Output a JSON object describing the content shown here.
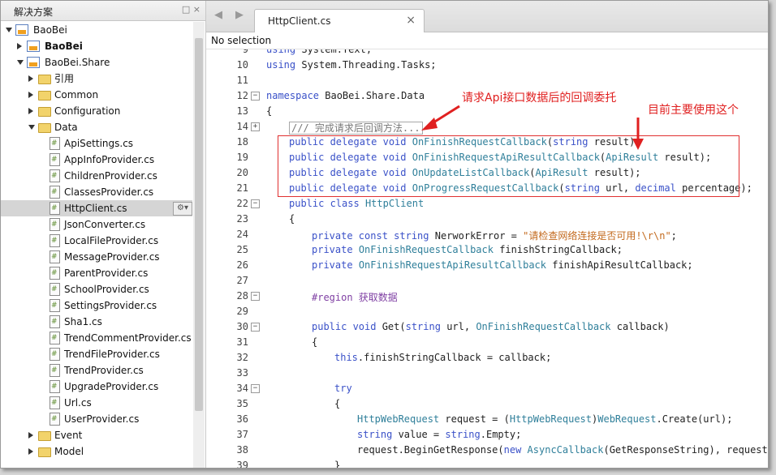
{
  "sidebar": {
    "title": "解决方案",
    "header_buttons": "□ ×",
    "items": [
      {
        "label": "BaoBei",
        "icon": "solution-icon"
      },
      {
        "label": "BaoBei",
        "icon": "project-icon"
      },
      {
        "label": "BaoBei.Share",
        "icon": "project-icon"
      },
      {
        "label": "引用",
        "icon": "folder-icon"
      },
      {
        "label": "Common",
        "icon": "folder-icon"
      },
      {
        "label": "Configuration",
        "icon": "folder-icon"
      },
      {
        "label": "Data",
        "icon": "folder-icon"
      },
      {
        "label": "ApiSettings.cs",
        "icon": "cs-file-icon"
      },
      {
        "label": "AppInfoProvider.cs",
        "icon": "cs-file-icon"
      },
      {
        "label": "ChildrenProvider.cs",
        "icon": "cs-file-icon"
      },
      {
        "label": "ClassesProvider.cs",
        "icon": "cs-file-icon"
      },
      {
        "label": "HttpClient.cs",
        "icon": "cs-file-icon"
      },
      {
        "label": "JsonConverter.cs",
        "icon": "cs-file-icon"
      },
      {
        "label": "LocalFileProvider.cs",
        "icon": "cs-file-icon"
      },
      {
        "label": "MessageProvider.cs",
        "icon": "cs-file-icon"
      },
      {
        "label": "ParentProvider.cs",
        "icon": "cs-file-icon"
      },
      {
        "label": "SchoolProvider.cs",
        "icon": "cs-file-icon"
      },
      {
        "label": "SettingsProvider.cs",
        "icon": "cs-file-icon"
      },
      {
        "label": "Sha1.cs",
        "icon": "cs-file-icon"
      },
      {
        "label": "TrendCommentProvider.cs",
        "icon": "cs-file-icon"
      },
      {
        "label": "TrendFileProvider.cs",
        "icon": "cs-file-icon"
      },
      {
        "label": "TrendProvider.cs",
        "icon": "cs-file-icon"
      },
      {
        "label": "UpgradeProvider.cs",
        "icon": "cs-file-icon"
      },
      {
        "label": "Url.cs",
        "icon": "cs-file-icon"
      },
      {
        "label": "UserProvider.cs",
        "icon": "cs-file-icon"
      },
      {
        "label": "Event",
        "icon": "folder-icon"
      },
      {
        "label": "Model",
        "icon": "folder-icon"
      }
    ],
    "selected": "HttpClient.cs"
  },
  "editor": {
    "tab_label": "HttpClient.cs",
    "tab_close": "×",
    "breadcrumb": "No selection",
    "nav_back": "◀",
    "nav_forward": "▶",
    "lines": [
      {
        "n": "9",
        "text": "using System.Text;"
      },
      {
        "n": "10",
        "text": "using System.Threading.Tasks;"
      },
      {
        "n": "11",
        "text": ""
      },
      {
        "n": "12",
        "text": "namespace BaoBei.Share.Data"
      },
      {
        "n": "13",
        "text": "{"
      },
      {
        "n": "14",
        "text": "/// 完成请求后回调方法..."
      },
      {
        "n": "18",
        "text": "public delegate void OnFinishRequestCallback(string result);"
      },
      {
        "n": "19",
        "text": "public delegate void OnFinishRequestApiResultCallback(ApiResult result);"
      },
      {
        "n": "20",
        "text": "public delegate void OnUpdateListCallback(ApiResult result);"
      },
      {
        "n": "21",
        "text": "public delegate void OnProgressRequestCallback(string url, decimal percentage);"
      },
      {
        "n": "22",
        "text": "public class HttpClient"
      },
      {
        "n": "23",
        "text": "{"
      },
      {
        "n": "24",
        "text": "private const string NerworkError = \"请检查网络连接是否可用!\\r\\n\";"
      },
      {
        "n": "25",
        "text": "private OnFinishRequestCallback finishStringCallback;"
      },
      {
        "n": "26",
        "text": "private OnFinishRequestApiResultCallback finishApiResultCallback;"
      },
      {
        "n": "27",
        "text": ""
      },
      {
        "n": "28",
        "text": "#region 获取数据"
      },
      {
        "n": "29",
        "text": ""
      },
      {
        "n": "30",
        "text": "public void Get(string url, OnFinishRequestCallback callback)"
      },
      {
        "n": "31",
        "text": "{"
      },
      {
        "n": "32",
        "text": "this.finishStringCallback = callback;"
      },
      {
        "n": "33",
        "text": ""
      },
      {
        "n": "34",
        "text": "try"
      },
      {
        "n": "35",
        "text": "{"
      },
      {
        "n": "36",
        "text": "HttpWebRequest request = (HttpWebRequest)WebRequest.Create(url);"
      },
      {
        "n": "37",
        "text": "string value = string.Empty;"
      },
      {
        "n": "38",
        "text": "request.BeginGetResponse(new AsyncCallback(GetResponseString), request);"
      },
      {
        "n": "39",
        "text": "}"
      }
    ]
  },
  "annotations": {
    "callback_note": "请求Api接口数据后的回调委托",
    "main_use_note": "目前主要使用这个"
  },
  "colors": {
    "keyword": "#3a51c8",
    "type": "#2f7f9a",
    "string": "#c36a1e",
    "annotation": "#e02020"
  }
}
